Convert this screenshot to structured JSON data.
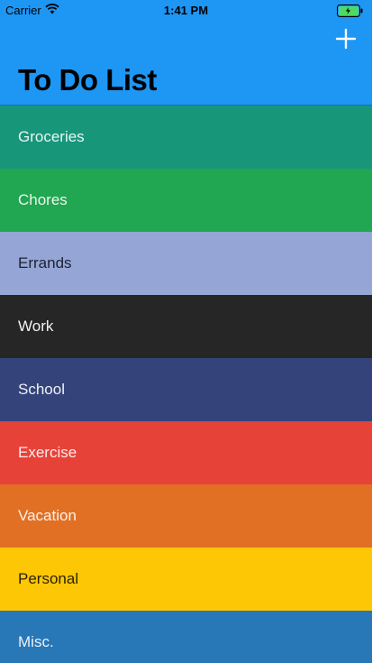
{
  "status_bar": {
    "carrier": "Carrier",
    "time": "1:41 PM",
    "battery_color": "#4cd964"
  },
  "nav": {
    "title": "To Do List",
    "add_icon": "plus-icon",
    "background": "#1e96f4"
  },
  "list": {
    "items": [
      {
        "label": "Groceries",
        "color": "#17967a",
        "text_color": "#eaf6f2"
      },
      {
        "label": "Chores",
        "color": "#21a651",
        "text_color": "#eaf6ee"
      },
      {
        "label": "Errands",
        "color": "#95a5d5",
        "text_color": "#1d2233"
      },
      {
        "label": "Work",
        "color": "#262626",
        "text_color": "#f2f2f2"
      },
      {
        "label": "School",
        "color": "#34447a",
        "text_color": "#eef0f6"
      },
      {
        "label": "Exercise",
        "color": "#e74238",
        "text_color": "#fdeceb"
      },
      {
        "label": "Vacation",
        "color": "#e17025",
        "text_color": "#fdf0e8"
      },
      {
        "label": "Personal",
        "color": "#fdc706",
        "text_color": "#2b2200"
      },
      {
        "label": "Misc.",
        "color": "#2877b6",
        "text_color": "#eaf2f9"
      }
    ]
  }
}
